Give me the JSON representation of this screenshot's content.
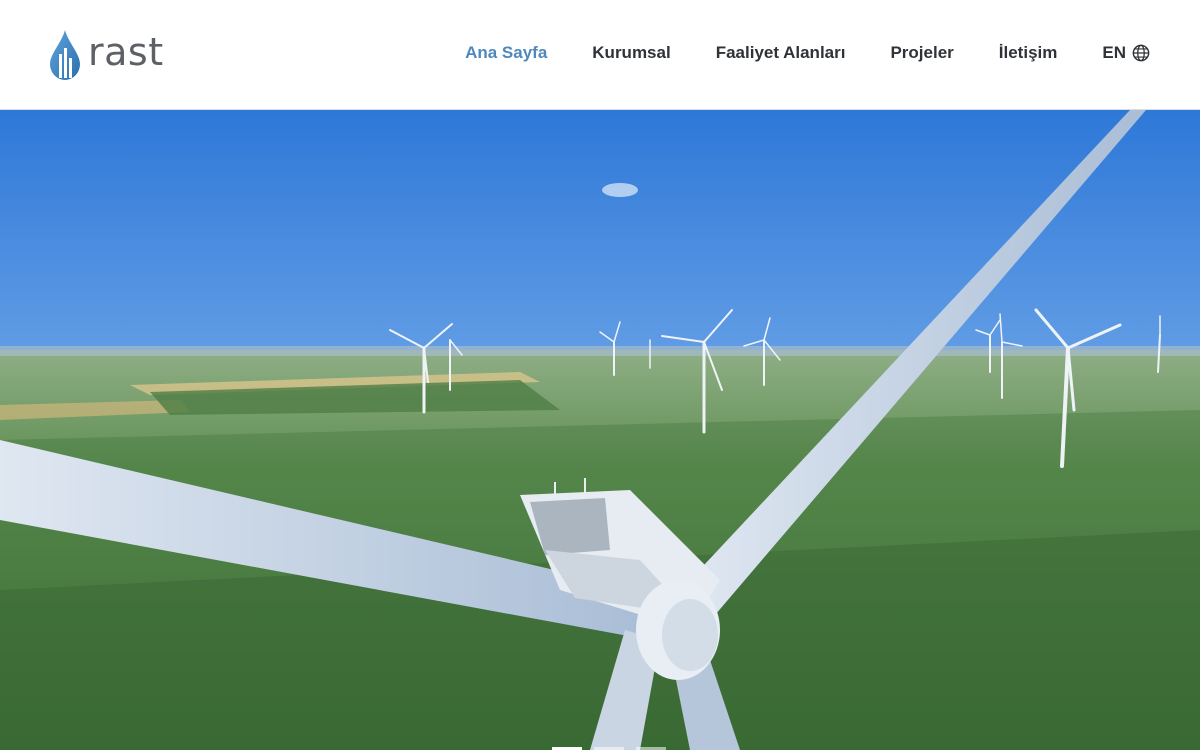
{
  "brand": {
    "name": "rast",
    "logo_icon": "droplet-bars-icon"
  },
  "nav": {
    "items": [
      {
        "label": "Ana Sayfa",
        "active": true
      },
      {
        "label": "Kurumsal",
        "active": false
      },
      {
        "label": "Faaliyet Alanları",
        "active": false
      },
      {
        "label": "Projeler",
        "active": false
      },
      {
        "label": "İletişim",
        "active": false
      }
    ],
    "language": {
      "label": "EN",
      "icon": "globe-icon"
    }
  },
  "hero": {
    "image": "wind-turbine-farm-aerial",
    "slides": [
      {
        "active": true
      },
      {
        "active": false
      },
      {
        "active": false
      }
    ]
  },
  "colors": {
    "accent": "#4f88bd",
    "text": "#2f3338",
    "logo_gray": "#5d6166"
  }
}
